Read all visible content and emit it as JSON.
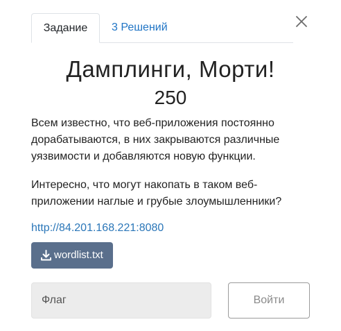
{
  "tabs": [
    {
      "label": "Задание",
      "active": true
    },
    {
      "label": "3 Решений",
      "active": false
    }
  ],
  "challenge": {
    "title": "Дамплинги, Морти!",
    "points": "250",
    "description": [
      "Всем известно, что веб-приложения постоянно дорабатываются, в них закрываются различные уязвимости и добавляются новую функции.",
      "Интересно, что могут накопать в таком веб-приложении наглые и грубые злоумышленники?"
    ],
    "link": "http://84.201.168.221:8080",
    "file_label": "wordlist.txt"
  },
  "form": {
    "flag_placeholder": "Флаг",
    "flag_value": "",
    "submit_label": "Войти"
  },
  "icons": {
    "close": "close-icon",
    "download": "download-icon"
  },
  "colors": {
    "link": "#2a76b8",
    "tab_inactive": "#1f74c5",
    "file_button_bg": "#5a6f8c",
    "input_bg": "#ececec"
  }
}
